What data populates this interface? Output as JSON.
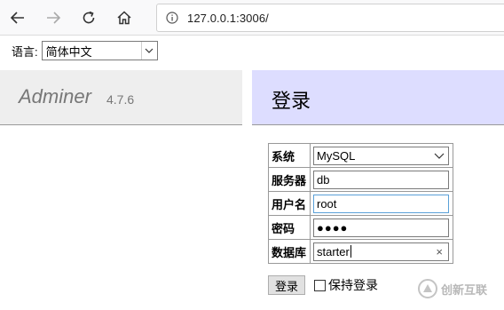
{
  "browser": {
    "address": "127.0.0.1:3006/",
    "icons": {
      "back": "back-arrow-icon",
      "forward": "forward-arrow-icon",
      "reload": "reload-icon",
      "home": "home-icon",
      "info": "info-icon"
    }
  },
  "language": {
    "label": "语言:",
    "selected": "简体中文"
  },
  "app": {
    "name": "Adminer",
    "version": "4.7.6"
  },
  "content": {
    "title": "登录"
  },
  "login_form": {
    "system_label": "系统",
    "system_value": "MySQL",
    "server_label": "服务器",
    "server_value": "db",
    "username_label": "用户名",
    "username_value": "root",
    "password_label": "密码",
    "password_mask": "●●●●",
    "database_label": "数据库",
    "database_value": "starter",
    "clear_symbol": "×",
    "submit_label": "登录",
    "remember_label": "保持登录"
  },
  "watermark": {
    "text": "创新互联"
  },
  "colors": {
    "menu_bg": "#eeeeee",
    "content_header_bg": "#ddddff",
    "app_name": "#777777"
  }
}
